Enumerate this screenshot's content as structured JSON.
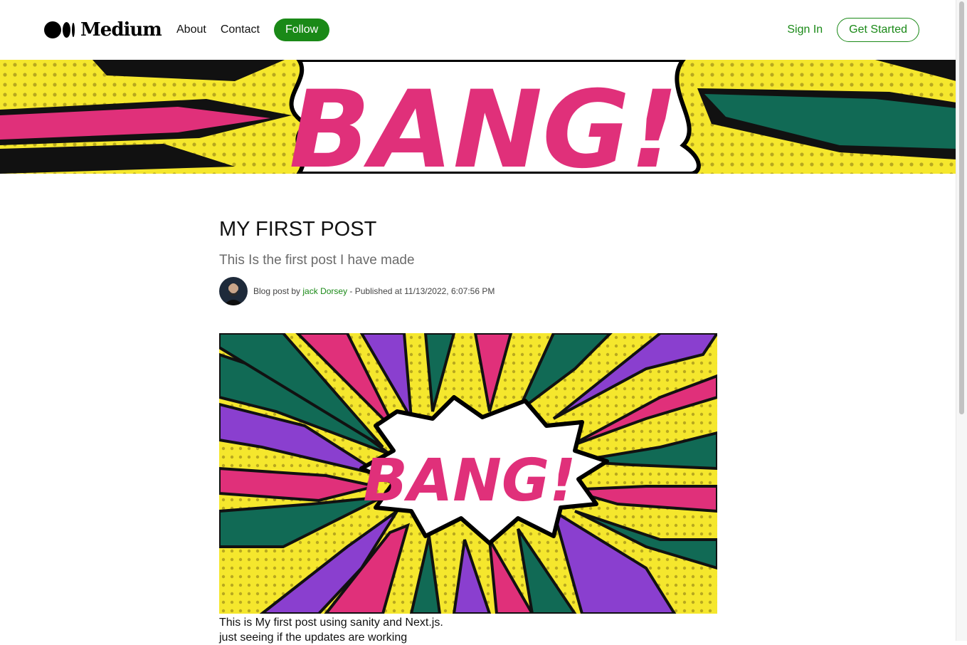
{
  "header": {
    "logo_text": "Medium",
    "nav": {
      "about": "About",
      "contact": "Contact"
    },
    "follow_label": "Follow",
    "sign_in_label": "Sign In",
    "get_started_label": "Get Started"
  },
  "banner": {
    "image_text": "BANG!"
  },
  "post": {
    "title": "MY FIRST POST",
    "subtitle": "This Is the first post I have made",
    "meta_prefix": "Blog post by",
    "author": "jack Dorsey",
    "meta_suffix": "- Published at 11/13/2022, 6:07:56 PM",
    "hero_image_text": "BANG!",
    "body": [
      "This is My first post using sanity and Next.js.",
      "just seeing if the updates are working"
    ]
  },
  "colors": {
    "brand_green": "#1a8917",
    "comic_yellow": "#f5e72d",
    "comic_pink": "#e0307a",
    "comic_purple": "#8a3fcf",
    "comic_teal": "#116a55"
  },
  "icons": {
    "logo": "medium-logo-icon"
  }
}
